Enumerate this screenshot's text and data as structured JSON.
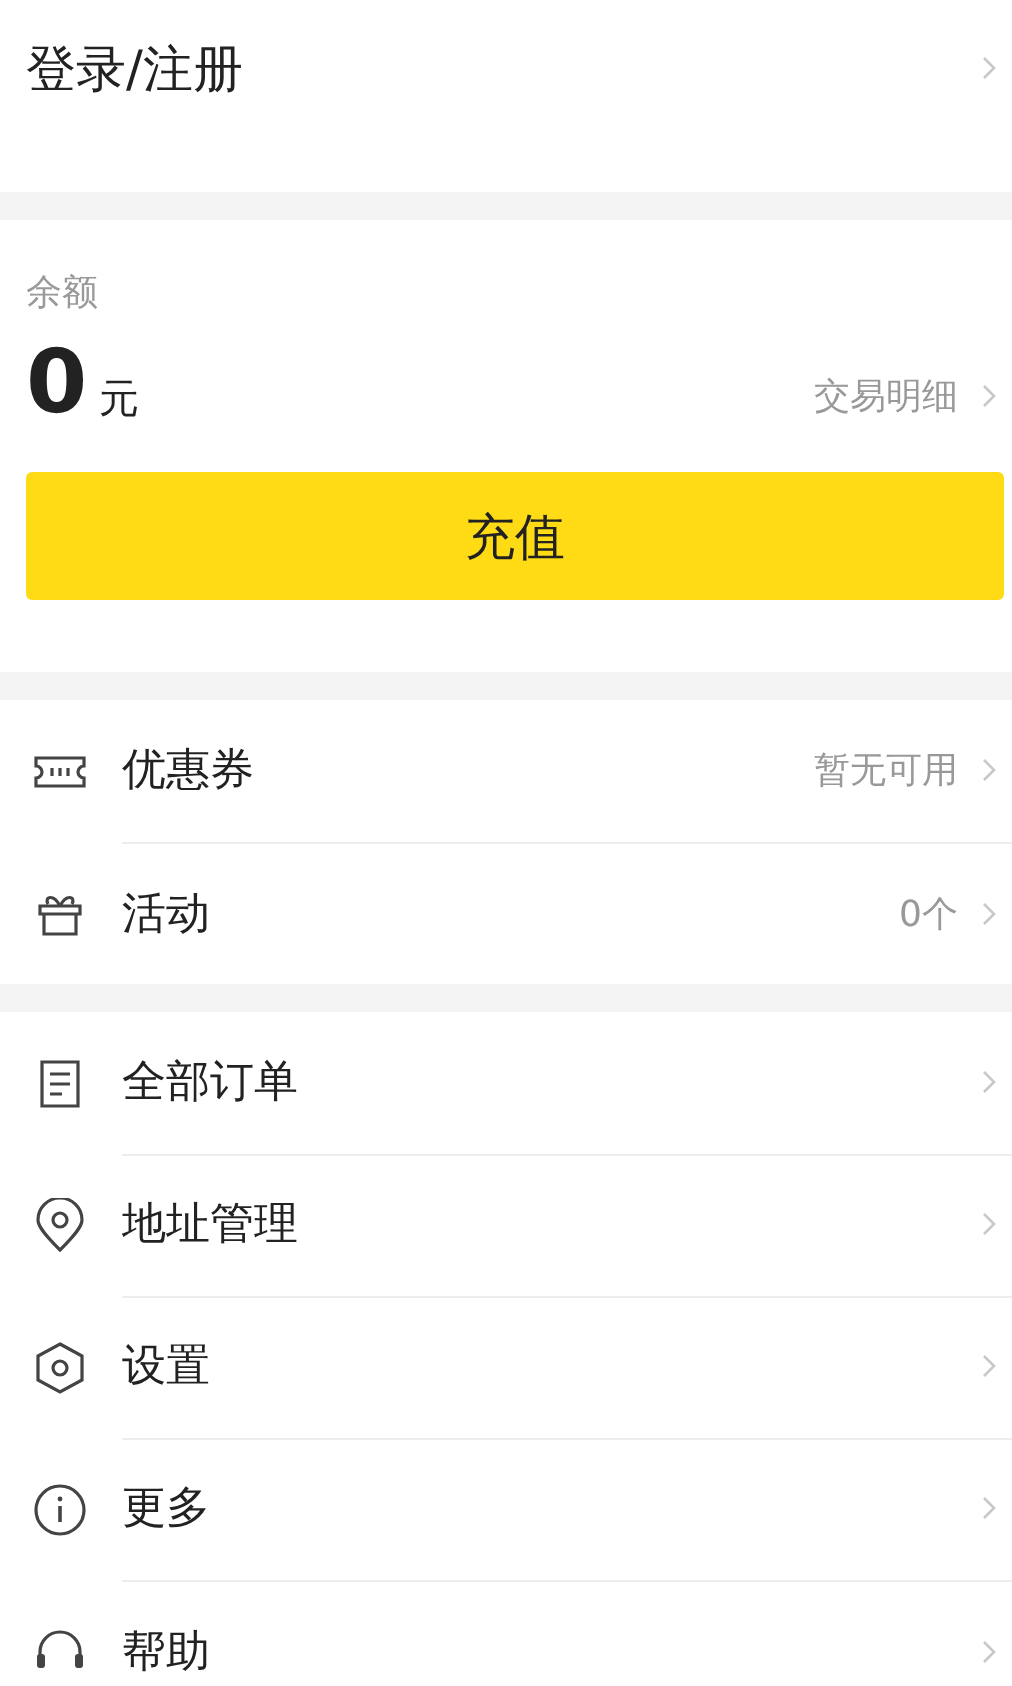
{
  "login": {
    "label": "登录/注册"
  },
  "balance": {
    "label": "余额",
    "amount": "0",
    "unit": "元",
    "details_link": "交易明细",
    "recharge_button": "充值"
  },
  "groups": [
    {
      "items": [
        {
          "label": "优惠券",
          "value": "暂无可用"
        },
        {
          "label": "活动",
          "value": "0个"
        }
      ]
    },
    {
      "items": [
        {
          "label": "全部订单"
        },
        {
          "label": "地址管理"
        },
        {
          "label": "设置"
        },
        {
          "label": "更多"
        },
        {
          "label": "帮助"
        }
      ]
    }
  ]
}
